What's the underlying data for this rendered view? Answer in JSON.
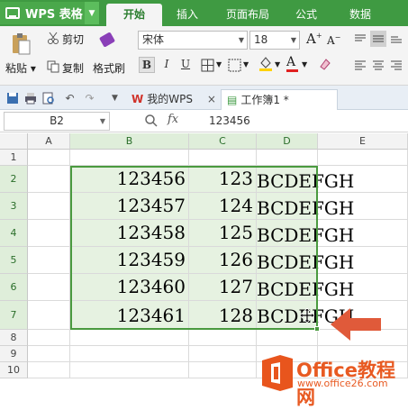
{
  "app": {
    "title": "WPS 表格"
  },
  "ribbon_tabs": [
    {
      "label": "开始",
      "active": true
    },
    {
      "label": "插入",
      "active": false
    },
    {
      "label": "页面布局",
      "active": false
    },
    {
      "label": "公式",
      "active": false
    },
    {
      "label": "数据",
      "active": false
    }
  ],
  "ribbon": {
    "paste_label": "粘贴",
    "cut_label": "剪切",
    "copy_label": "复制",
    "format_painter_label": "格式刷",
    "font_name": "宋体",
    "font_size": "18",
    "bold": "B",
    "italic": "I",
    "underline": "U",
    "font_color_letter": "A",
    "grow_font": "A",
    "shrink_font": "A",
    "accent_color": "#3f9a42",
    "font_color": "#e02020",
    "highlight_color": "#ffd200"
  },
  "doc_tabs": [
    {
      "label": "我的WPS",
      "close": "×",
      "active": false
    },
    {
      "label": "工作簿1 *",
      "active": true
    }
  ],
  "formula_bar": {
    "name_box": "B2",
    "fx": "fx",
    "value": "123456"
  },
  "sheet": {
    "columns": [
      "A",
      "B",
      "C",
      "D",
      "E"
    ],
    "rows": [
      "1",
      "2",
      "3",
      "4",
      "5",
      "6",
      "7",
      "8",
      "9",
      "10"
    ],
    "col_b": [
      "123456",
      "123457",
      "123458",
      "123459",
      "123460",
      "123461"
    ],
    "col_c": [
      "123",
      "124",
      "125",
      "126",
      "127",
      "128"
    ],
    "col_d_visible": "BCDEFGH",
    "selection_color": "#4a9a3f"
  },
  "watermark": {
    "line1": "Office教程网",
    "line2": "www.office26.com"
  }
}
